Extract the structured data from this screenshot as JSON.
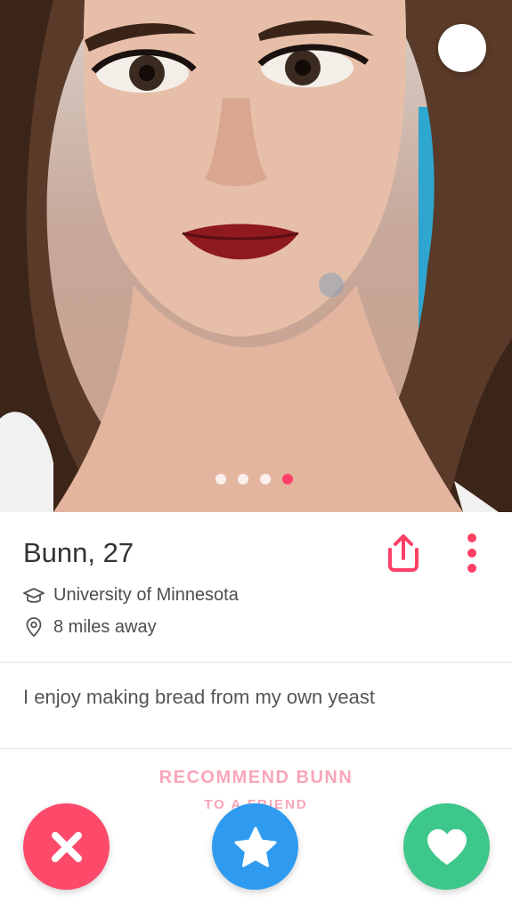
{
  "profile": {
    "name": "Bunn",
    "age": ", 27",
    "school": "University of Minnesota",
    "distance": "8 miles away",
    "bio": "I enjoy making bread from my own yeast"
  },
  "photo": {
    "count": 4,
    "active_index": 3,
    "description_icon": "profile-photo"
  },
  "recommend": {
    "title": "RECOMMEND BUNN",
    "subtitle": "TO A FRIEND"
  },
  "colors": {
    "accent": "#fd3f66",
    "nope": "#fd4a6a",
    "superlike": "#2e9bf0",
    "like": "#3ec78a",
    "recommend": "#f9a6b8"
  },
  "icons": {
    "collapse": "arrow-down-icon",
    "share": "share-icon",
    "more": "more-vertical-icon",
    "school": "graduation-cap-icon",
    "location": "location-pin-icon",
    "nope": "close-icon",
    "superlike": "star-icon",
    "like": "heart-icon"
  }
}
